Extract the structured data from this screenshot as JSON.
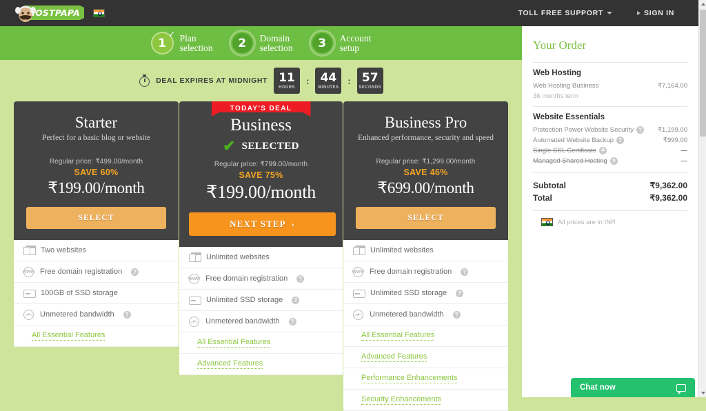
{
  "header": {
    "logo_text": "HOSTPAPA",
    "flag": "india-flag",
    "nav": [
      {
        "label": "TOLL FREE SUPPORT",
        "icon": "chevron-down-icon"
      },
      {
        "label": "SIGN IN",
        "icon": "chevron-right-icon"
      }
    ]
  },
  "steps": [
    {
      "number": "1",
      "label": "Plan\nselection",
      "line1": "Plan",
      "line2": "selection",
      "state": "done",
      "check": "✓"
    },
    {
      "number": "2",
      "label": "Domain selection",
      "line1": "Domain",
      "line2": "selection",
      "state": "todo"
    },
    {
      "number": "3",
      "label": "Account setup",
      "line1": "Account",
      "line2": "setup",
      "state": "todo"
    }
  ],
  "countdown": {
    "icon": "stopwatch-icon",
    "label": "DEAL EXPIRES AT MIDNIGHT",
    "separator": ":",
    "units": [
      {
        "value": "11",
        "unit": "HOURS"
      },
      {
        "value": "44",
        "unit": "MINUTES"
      },
      {
        "value": "57",
        "unit": "SECONDS"
      }
    ]
  },
  "plans": [
    {
      "name": "Starter",
      "desc": "Perfect for a basic blog or website",
      "regular_price": "Regular price: ₹499.00/month",
      "save": "SAVE 60%",
      "price": "₹199.00/month",
      "button": "SELECT",
      "selected": false,
      "features": [
        {
          "icon": "websites-icon",
          "text": "Two websites",
          "help": false
        },
        {
          "icon": "www-globe-icon",
          "text": "Free domain registration",
          "help": true
        },
        {
          "icon": "ssd-storage-icon",
          "text": "100GB of SSD storage",
          "help": false
        },
        {
          "icon": "bandwidth-icon",
          "text": "Unmetered bandwidth",
          "help": true
        }
      ],
      "links": [
        "All Essential Features"
      ]
    },
    {
      "name": "Business",
      "ribbon": "TODAY'S DEAL",
      "selected": true,
      "selected_label": "SELECTED",
      "selected_check": "✔",
      "regular_price": "Regular price: ₹799.00/month",
      "save": "SAVE 75%",
      "price": "₹199.00/month",
      "button": "NEXT STEP",
      "button_arrow": "›",
      "features": [
        {
          "icon": "websites-icon",
          "text": "Unlimited websites",
          "help": false
        },
        {
          "icon": "www-globe-icon",
          "text": "Free domain registration",
          "help": true
        },
        {
          "icon": "ssd-storage-icon",
          "text": "Unlimited SSD storage",
          "help": true
        },
        {
          "icon": "bandwidth-icon",
          "text": "Unmetered bandwidth",
          "help": true
        }
      ],
      "links": [
        "All Essential Features",
        "Advanced Features"
      ]
    },
    {
      "name": "Business Pro",
      "desc": "Enhanced performance, security and speed",
      "regular_price": "Regular price: ₹1,299.00/month",
      "save": "SAVE 46%",
      "price": "₹699.00/month",
      "button": "SELECT",
      "selected": false,
      "features": [
        {
          "icon": "websites-icon",
          "text": "Unlimited websites",
          "help": false
        },
        {
          "icon": "www-globe-icon",
          "text": "Free domain registration",
          "help": true
        },
        {
          "icon": "ssd-storage-icon",
          "text": "Unlimited SSD storage",
          "help": true
        },
        {
          "icon": "bandwidth-icon",
          "text": "Unmetered bandwidth",
          "help": true
        }
      ],
      "links": [
        "All Essential Features",
        "Advanced Features",
        "Performance Enhancements",
        "Security Enhancements"
      ]
    }
  ],
  "order": {
    "title": "Your Order",
    "sections": [
      {
        "title": "Web Hosting",
        "rows": [
          {
            "name": "Web Hosting Business",
            "sub": "36 months term",
            "value": "₹7,164.00",
            "help": false,
            "strike": false
          }
        ]
      },
      {
        "title": "Website Essentials",
        "rows": [
          {
            "name": "Protection Power Website Security",
            "value": "₹1,199.00",
            "help": true,
            "strike": false
          },
          {
            "name": "Automated Website Backup",
            "value": "₹999.00",
            "help": true,
            "strike": false
          },
          {
            "name": "Single SSL Certificate",
            "value": "—",
            "help": true,
            "strike": true
          },
          {
            "name": "Managed Shared Hosting",
            "value": "—",
            "help": true,
            "strike": true
          }
        ]
      }
    ],
    "totals": [
      {
        "label": "Subtotal",
        "value": "₹9,362.00"
      },
      {
        "label": "Total",
        "value": "₹9,362.00"
      }
    ],
    "currency_note": "All prices are in INR",
    "currency_flag": "india-flag"
  },
  "chat": {
    "label": "Chat now",
    "icon": "chat-bubble-icon"
  },
  "colors": {
    "brand_green": "#7ac143",
    "steps_green": "#6fbe44",
    "page_bg": "#cde49a",
    "card_dark": "#434343",
    "accent_orange": "#f7941d",
    "select_orange": "#eeb15e",
    "save_orange": "#f5a623",
    "deal_red": "#ed1c24",
    "chat_green": "#25c16f"
  }
}
